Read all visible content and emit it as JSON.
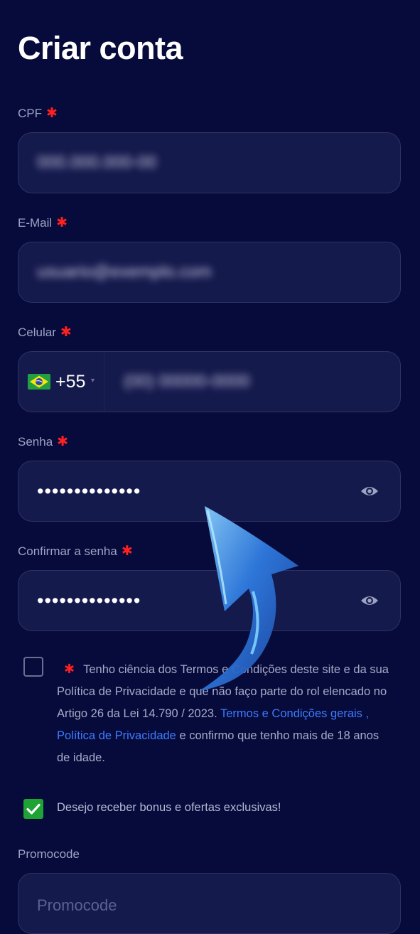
{
  "page": {
    "title": "Criar conta"
  },
  "form": {
    "cpf": {
      "label": "CPF",
      "required_mark": "✱",
      "value": "000.000.000-00"
    },
    "email": {
      "label": "E-Mail",
      "required_mark": "✱",
      "value": "usuario@exemplo.com"
    },
    "phone": {
      "label": "Celular",
      "required_mark": "✱",
      "country_code": "+55",
      "caret": "▾",
      "value": "(00) 00000-0000"
    },
    "password": {
      "label": "Senha",
      "required_mark": "✱",
      "value": "••••••••••••••"
    },
    "confirm_password": {
      "label": "Confirmar a senha",
      "required_mark": "✱",
      "value": "••••••••••••••"
    },
    "terms": {
      "checked": false,
      "required_mark": "✱",
      "text": "Tenho ciência dos Termos e Condições deste site e da sua Política de Privacidade e que não faço parte do rol elencado no Artigo 26 da Lei 14.790 / 2023.",
      "link_text": "Termos e Condições gerais , Política de Privacidade",
      "suffix": "e confirmo que tenho mais de 18 anos de idade."
    },
    "offers": {
      "checked": true,
      "label": "Desejo receber bonus e ofertas exclusivas!"
    },
    "promocode": {
      "label": "Promocode",
      "placeholder": "Promocode"
    }
  },
  "colors": {
    "background": "#070b3b",
    "field": "#151a4d",
    "required": "#ff2020",
    "link": "#3d7bff",
    "checkbox_checked": "#1fa334"
  },
  "icons": {
    "eye": "eye-icon",
    "flag": "brazil-flag-icon",
    "arrow": "curved-arrow-overlay"
  }
}
